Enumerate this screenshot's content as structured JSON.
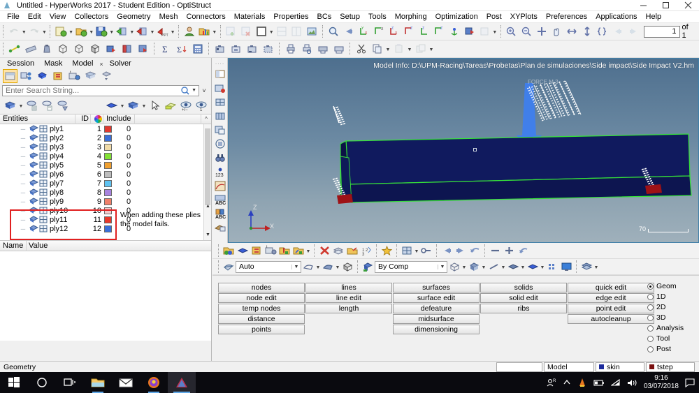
{
  "window": {
    "title": "Untitled - HyperWorks 2017 - Student Edition - OptiStruct",
    "app_icon": "hyperworks-logo-icon",
    "minimize": "minimize-button",
    "maximize": "maximize-button",
    "close": "close-button"
  },
  "menu": {
    "items": [
      {
        "label": "File"
      },
      {
        "label": "Edit"
      },
      {
        "label": "View"
      },
      {
        "label": "Collectors"
      },
      {
        "label": "Geometry"
      },
      {
        "label": "Mesh"
      },
      {
        "label": "Connectors"
      },
      {
        "label": "Materials"
      },
      {
        "label": "Properties"
      },
      {
        "label": "BCs"
      },
      {
        "label": "Setup"
      },
      {
        "label": "Tools"
      },
      {
        "label": "Morphing"
      },
      {
        "label": "Optimization"
      },
      {
        "label": "Post"
      },
      {
        "label": "XYPlots"
      },
      {
        "label": "Preferences"
      },
      {
        "label": "Applications"
      },
      {
        "label": "Help"
      }
    ]
  },
  "toolbar_pages": {
    "prev_label": "previous-page-arrow",
    "next_label": "next-page-arrow",
    "page_value": "1",
    "page_of": "of 1"
  },
  "browser": {
    "tabs": [
      {
        "label": "Session",
        "active": false
      },
      {
        "label": "Mask",
        "active": false
      },
      {
        "label": "Model",
        "active": true
      },
      {
        "label": "Solver",
        "active": false
      }
    ],
    "close_tab": "×",
    "view_icons": [
      "model-browser-icon",
      "assembly-browser-icon",
      "component-browser-icon",
      "properties-browser-icon",
      "solver-browser-icon",
      "include-browser-icon",
      "utility-browser-icon"
    ],
    "search": {
      "placeholder": "Enter Search String...",
      "value": ""
    },
    "columns": {
      "entities": "Entities",
      "id": "ID",
      "color": "color-wheel-icon",
      "include": "Include"
    },
    "rows": [
      {
        "name": "ply1",
        "id": "1",
        "color": "#e03a30",
        "include": "0"
      },
      {
        "name": "ply2",
        "id": "2",
        "color": "#3a6fd8",
        "include": "0"
      },
      {
        "name": "ply3",
        "id": "3",
        "color": "#f0dba8",
        "include": "0"
      },
      {
        "name": "ply4",
        "id": "4",
        "color": "#84e236",
        "include": "0"
      },
      {
        "name": "ply5",
        "id": "5",
        "color": "#f0a030",
        "include": "0"
      },
      {
        "name": "ply6",
        "id": "6",
        "color": "#bdbdbd",
        "include": "0"
      },
      {
        "name": "ply7",
        "id": "7",
        "color": "#5fc3f2",
        "include": "0"
      },
      {
        "name": "ply8",
        "id": "8",
        "color": "#a884e0",
        "include": "0"
      },
      {
        "name": "ply9",
        "id": "9",
        "color": "#f0806a",
        "include": "0"
      },
      {
        "name": "ply10",
        "id": "10",
        "color": "#f2c9c9",
        "include": "0"
      },
      {
        "name": "ply11",
        "id": "11",
        "color": "#e8382a",
        "include": "0"
      },
      {
        "name": "ply12",
        "id": "12",
        "color": "#3a6fd8",
        "include": "0"
      }
    ],
    "annotation": "When adding these plies the model fails.",
    "annotation_color": "#e02020",
    "name_value": {
      "name": "Name",
      "value": "Value"
    }
  },
  "viewport": {
    "model_info": "Model Info: D:\\UPM-Racing\\Tareas\\Probetas\\Plan de simulaciones\\Side impact\\Side Impact V2.hm",
    "scale_value": "70",
    "axis_z": "Z",
    "axis_x": "X",
    "force_label": "FORCE",
    "bg_color_top": "#4e6f8e",
    "bg_color_bottom": "#9fb0bb",
    "mesh_color": "#101a5e",
    "outline_color": "#36e03a",
    "arrow_color": "#3e7ff0",
    "support_color": "#9e1216"
  },
  "viewport_toolbar": {
    "display_combo": "Auto",
    "color_combo": "By Comp"
  },
  "panel": {
    "columns": [
      [
        "nodes",
        "node edit",
        "temp nodes",
        "distance",
        "points"
      ],
      [
        "lines",
        "line edit",
        "length",
        "",
        ""
      ],
      [
        "surfaces",
        "surface edit",
        "defeature",
        "midsurface",
        "dimensioning"
      ],
      [
        "solids",
        "solid edit",
        "ribs",
        "",
        ""
      ],
      [
        "quick edit",
        "edge edit",
        "point edit",
        "autocleanup",
        ""
      ]
    ],
    "modes": [
      {
        "label": "Geom",
        "selected": true
      },
      {
        "label": "1D",
        "selected": false
      },
      {
        "label": "2D",
        "selected": false
      },
      {
        "label": "3D",
        "selected": false
      },
      {
        "label": "Analysis",
        "selected": false
      },
      {
        "label": "Tool",
        "selected": false
      },
      {
        "label": "Post",
        "selected": false
      }
    ]
  },
  "status": {
    "left": "Geometry",
    "field_blank": "",
    "field_model": "Model",
    "field_skin": "skin",
    "field_skin_color": "#1c2a9c",
    "field_tstep": "tstep",
    "field_tstep_color": "#7a1010"
  },
  "taskbar": {
    "items": [
      {
        "name": "start-button-icon"
      },
      {
        "name": "cortana-search-icon"
      },
      {
        "name": "task-view-icon"
      },
      {
        "name": "file-explorer-icon"
      },
      {
        "name": "mail-icon"
      },
      {
        "name": "firefox-icon"
      },
      {
        "name": "hyperworks-icon"
      }
    ],
    "tray": {
      "people_icon": "people-icon",
      "chevron_icon": "show-hidden-icons-chevron",
      "vlc_icon": "vlc-icon",
      "battery_icon": "battery-icon",
      "wifi_icon": "wifi-icon",
      "volume_icon": "volume-icon",
      "time": "9:16",
      "date": "03/07/2018",
      "action_center_icon": "action-center-icon"
    }
  }
}
